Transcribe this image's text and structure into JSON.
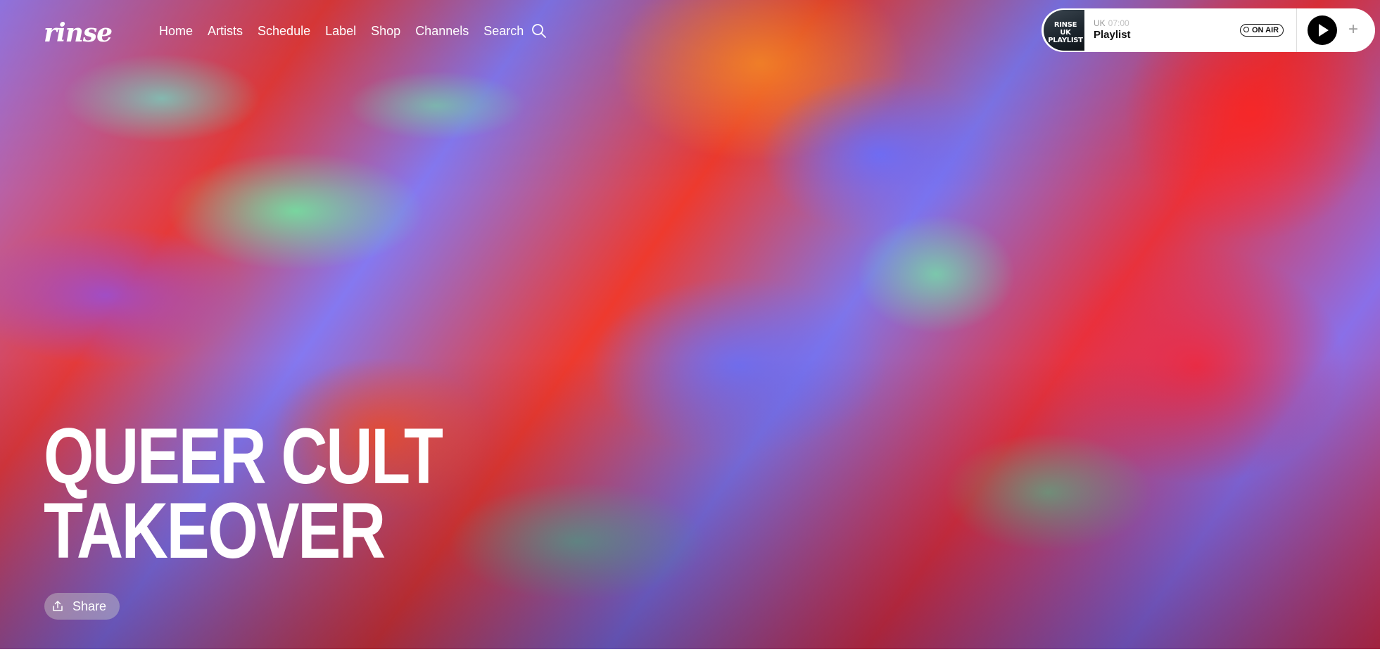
{
  "brand": {
    "logo_text": "rinse"
  },
  "nav": {
    "items": [
      {
        "label": "Home"
      },
      {
        "label": "Artists"
      },
      {
        "label": "Schedule"
      },
      {
        "label": "Label"
      },
      {
        "label": "Shop"
      },
      {
        "label": "Channels"
      },
      {
        "label": "Search"
      }
    ],
    "search_icon": "search-icon"
  },
  "player": {
    "thumbnail_text_line1": "RINSE UK",
    "thumbnail_text_line2": "PLAYLIST",
    "channel": "UK",
    "time": "07:00",
    "show_title": "Playlist",
    "status_badge": "ON AIR",
    "play_icon": "play-icon",
    "add_icon": "plus-icon",
    "add_label": "+"
  },
  "hero": {
    "title_line1": "QUEER CULT",
    "title_line2": "TAKEOVER",
    "share_label": "Share",
    "share_icon": "share-icon"
  },
  "colors": {
    "text": "#ffffff",
    "player_bg": "#ffffff",
    "play_button": "#000000",
    "muted": "#9a9a9a"
  }
}
